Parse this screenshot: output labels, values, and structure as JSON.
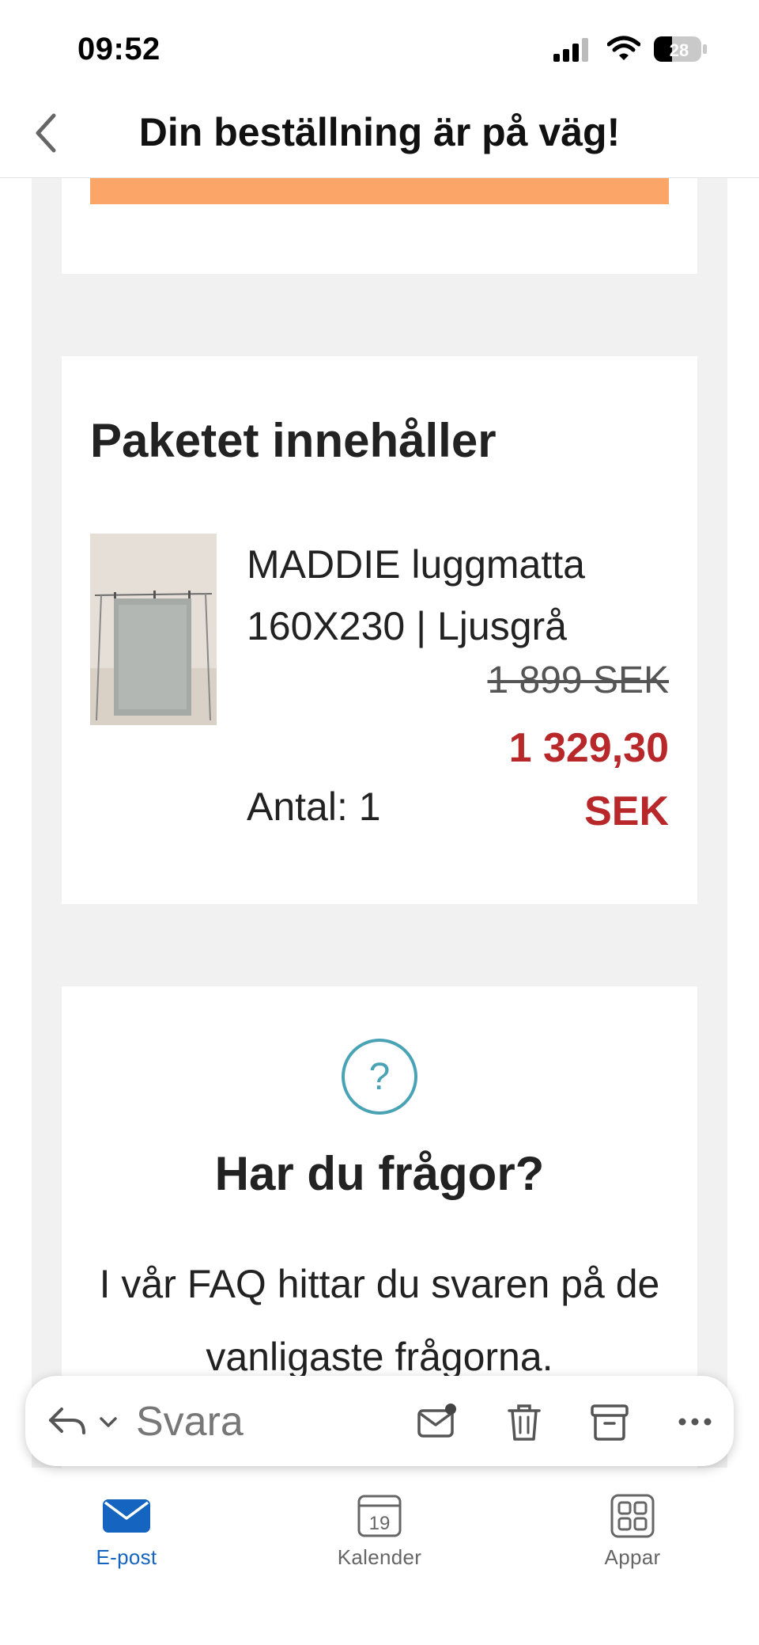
{
  "status_bar": {
    "time": "09:52",
    "battery": "28"
  },
  "header": {
    "title": "Din beställning är på väg!"
  },
  "package": {
    "title": "Paketet innehåller",
    "product_name": "MADDIE luggmatta 160X230 | Ljusgrå",
    "old_price": "1 899 SEK",
    "new_price": "1 329,30 SEK",
    "quantity": "Antal: 1"
  },
  "help": {
    "title": "Har du frågor?",
    "text": "I vår FAQ hittar du svaren på de vanligaste frågorna."
  },
  "reply_bar": {
    "reply_label": "Svara"
  },
  "tabs": [
    {
      "label": "E-post",
      "icon": "mail-icon",
      "active": true
    },
    {
      "label": "Kalender",
      "icon": "calendar-icon",
      "day": "19"
    },
    {
      "label": "Appar",
      "icon": "apps-grid-icon"
    }
  ],
  "colors": {
    "accent": "#1565c0",
    "sale_price": "#b8282a",
    "orange_banner": "#fba668",
    "help_icon": "#4aa3b5"
  }
}
